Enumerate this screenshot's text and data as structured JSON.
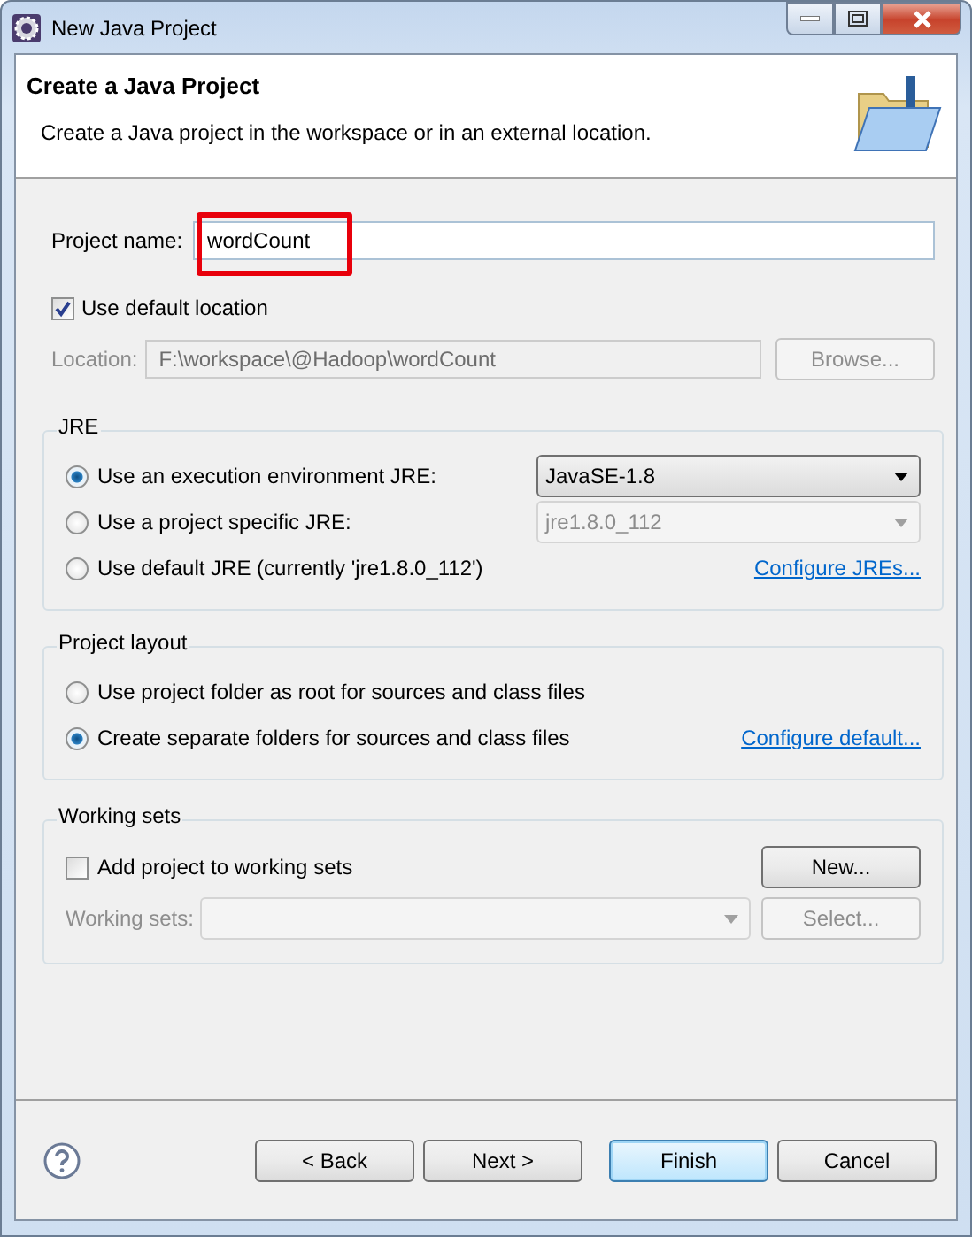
{
  "window": {
    "title": "New Java Project"
  },
  "header": {
    "title": "Create a Java Project",
    "description": "Create a Java project in the workspace or in an external location."
  },
  "project_name": {
    "label": "Project name:",
    "value": "wordCount"
  },
  "default_location": {
    "label": "Use default location",
    "checked": true
  },
  "location": {
    "label": "Location:",
    "value": "F:\\workspace\\@Hadoop\\wordCount",
    "browse": "Browse..."
  },
  "jre": {
    "title": "JRE",
    "options": [
      {
        "label": "Use an execution environment JRE:",
        "selected": true,
        "dropdown": "JavaSE-1.8"
      },
      {
        "label": "Use a project specific JRE:",
        "selected": false,
        "dropdown": "jre1.8.0_112"
      },
      {
        "label": "Use default JRE (currently 'jre1.8.0_112')",
        "selected": false,
        "link": "Configure JREs..."
      }
    ]
  },
  "project_layout": {
    "title": "Project layout",
    "options": [
      {
        "label": "Use project folder as root for sources and class files",
        "selected": false
      },
      {
        "label": "Create separate folders for sources and class files",
        "selected": true,
        "link": "Configure default..."
      }
    ]
  },
  "working_sets": {
    "title": "Working sets",
    "add": {
      "label": "Add project to working sets",
      "checked": false
    },
    "new_button": "New...",
    "label": "Working sets:",
    "select_button": "Select..."
  },
  "buttons": [
    {
      "label": "< Back",
      "default": false
    },
    {
      "label": "Next >",
      "default": false
    },
    {
      "label": "Finish",
      "default": true
    },
    {
      "label": "Cancel",
      "default": false
    }
  ]
}
